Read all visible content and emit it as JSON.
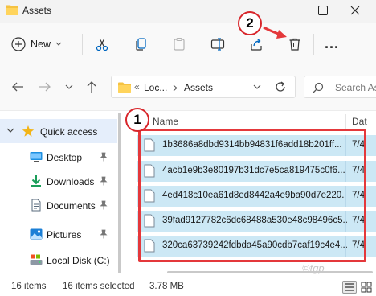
{
  "window": {
    "title": "Assets"
  },
  "toolbar": {
    "new_label": "New",
    "more_label": "..."
  },
  "address": {
    "crumbs": [
      "Loc...",
      "Assets"
    ],
    "separator": "«",
    "search_placeholder": "Search As"
  },
  "sidebar": {
    "items": [
      {
        "label": "Quick access",
        "icon": "star-icon"
      },
      {
        "label": "Desktop",
        "icon": "desktop-icon"
      },
      {
        "label": "Downloads",
        "icon": "download-icon"
      },
      {
        "label": "Documents",
        "icon": "document-icon"
      },
      {
        "label": "Pictures",
        "icon": "pictures-icon"
      },
      {
        "label": "Local Disk (C:)",
        "icon": "drive-icon"
      }
    ]
  },
  "filelist": {
    "col_name": "Name",
    "col_date": "Dat",
    "rows": [
      {
        "name": "1b3686a8dbd9314bb94831f6add18b201ff...",
        "date": "7/4"
      },
      {
        "name": "4acb1e9b3e80197b31dc7e5ca819475c0f6...",
        "date": "7/4"
      },
      {
        "name": "4ed418c10ea61d8ed8442a4e9ba90d7e220...",
        "date": "7/4"
      },
      {
        "name": "39fad9127782c6dc68488a530e48c98496c5...",
        "date": "7/4"
      },
      {
        "name": "320ca63739242fdbda45a90cdb7caf19c4e4...",
        "date": "7/4"
      }
    ]
  },
  "callouts": {
    "first": "1",
    "second": "2"
  },
  "status": {
    "items_count": "16 items",
    "selected": "16 items selected",
    "size": "3.78 MB"
  },
  "watermark": "©tgp",
  "colors": {
    "selection": "#cce8f5",
    "highlight_box": "#e4383b",
    "accent": "#0067c0"
  }
}
